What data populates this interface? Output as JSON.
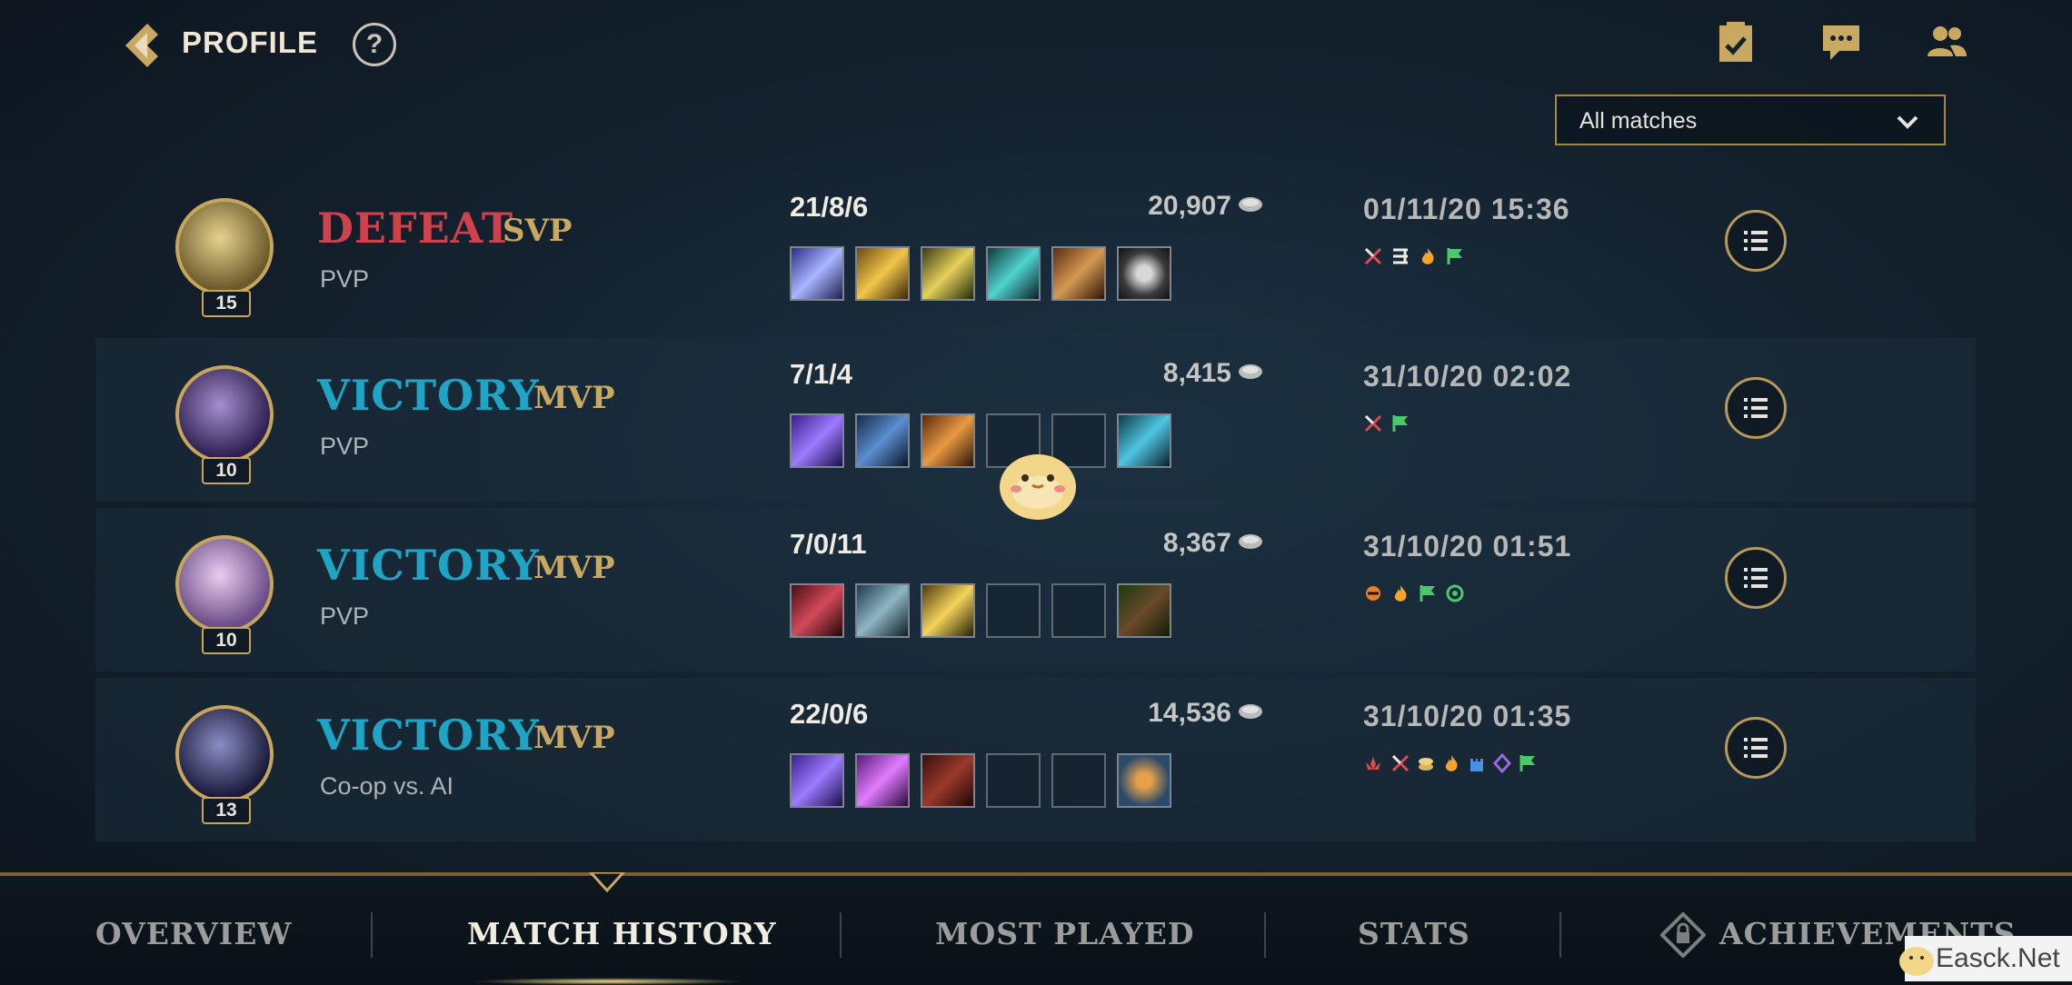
{
  "header": {
    "title": "PROFILE",
    "help_label": "?",
    "icons": [
      "back-icon",
      "help-icon",
      "missions-icon",
      "chat-icon",
      "friends-icon"
    ]
  },
  "filter": {
    "selected": "All matches"
  },
  "matches": [
    {
      "result": "DEFEAT",
      "badge": "SVP",
      "mode": "PVP",
      "level": "15",
      "kda": "21/8/6",
      "gold": "20,907",
      "datetime": "01/11/20 15:36",
      "items": [
        "blade-item",
        "lightning-blade-item",
        "spear-item",
        "crystal-item",
        "armor-item",
        "band-item"
      ],
      "awards": [
        "crossed-swords-icon",
        "triple-kill-icon",
        "fire-icon",
        "flag-icon"
      ],
      "portrait_color": "#b9a56a"
    },
    {
      "result": "VICTORY",
      "badge": "MVP",
      "mode": "PVP",
      "level": "10",
      "kda": "7/1/4",
      "gold": "8,415",
      "datetime": "31/10/20 02:02",
      "items": [
        "scepter-item",
        "tome-item",
        "orb-item",
        "empty",
        "empty",
        "boots-item"
      ],
      "awards": [
        "crossed-swords-icon",
        "flag-icon"
      ],
      "portrait_color": "#7a5fa8"
    },
    {
      "result": "VICTORY",
      "badge": "MVP",
      "mode": "PVP",
      "level": "10",
      "kda": "7/0/11",
      "gold": "8,367",
      "datetime": "31/10/20 01:51",
      "items": [
        "helmet-item",
        "cloak-item",
        "spear-item",
        "empty",
        "empty",
        "boots-item"
      ],
      "awards": [
        "dragon-icon",
        "fire-icon",
        "flag-icon",
        "ward-icon"
      ],
      "portrait_color": "#c8a6d6"
    },
    {
      "result": "VICTORY",
      "badge": "MVP",
      "mode": "Co-op vs. AI",
      "level": "13",
      "kda": "22/0/6",
      "gold": "14,536",
      "datetime": "31/10/20 01:35",
      "items": [
        "scepter-item",
        "book-item",
        "hat-item",
        "empty",
        "empty",
        "trinket-item"
      ],
      "awards": [
        "lotus-icon",
        "crossed-swords-icon",
        "coins-icon",
        "fire-icon",
        "tower-icon",
        "crystal-icon",
        "flag-icon"
      ],
      "portrait_color": "#3a3f6a"
    }
  ],
  "tabs": [
    {
      "label": "OVERVIEW"
    },
    {
      "label": "MATCH HISTORY",
      "active": true
    },
    {
      "label": "MOST PLAYED"
    },
    {
      "label": "STATS"
    },
    {
      "label": "ACHIEVEMENTS"
    }
  ],
  "watermark": {
    "text": "Easck.Net"
  },
  "colors": {
    "defeat": "#d0424b",
    "victory": "#1ea5c6",
    "gold_accent": "#c9a862"
  }
}
